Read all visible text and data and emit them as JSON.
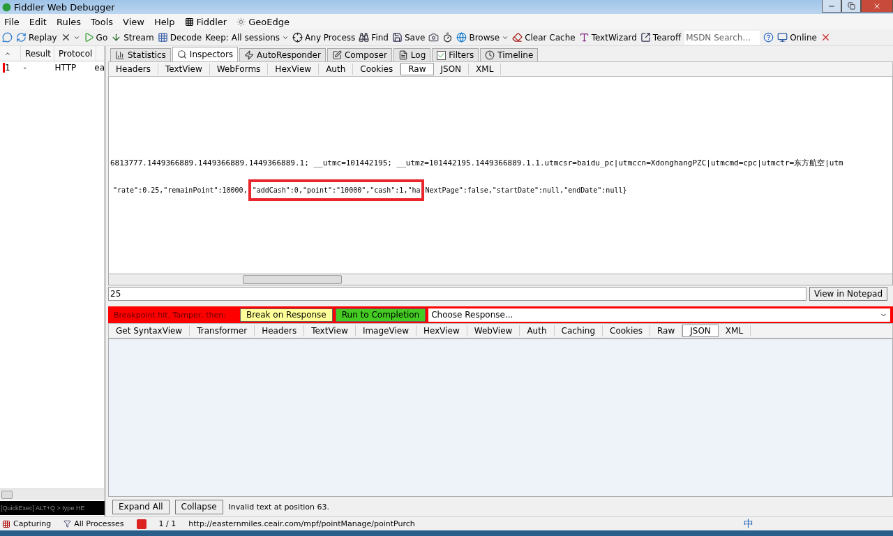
{
  "window": {
    "title": "Fiddler Web Debugger"
  },
  "menu": [
    {
      "label": "File",
      "kind": "text"
    },
    {
      "label": "Edit",
      "kind": "text"
    },
    {
      "label": "Rules",
      "kind": "text"
    },
    {
      "label": "Tools",
      "kind": "text"
    },
    {
      "label": "View",
      "kind": "text"
    },
    {
      "label": "Help",
      "kind": "text"
    },
    {
      "label": "Fiddler",
      "kind": "icon"
    },
    {
      "label": "GeoEdge",
      "kind": "icon"
    }
  ],
  "toolbar": [
    {
      "kind": "icon"
    },
    {
      "label": "Replay",
      "kind": "button"
    },
    {
      "kind": "dropdown"
    },
    {
      "label": "Go",
      "kind": "button"
    },
    {
      "label": "Stream",
      "kind": "button"
    },
    {
      "label": "Decode",
      "kind": "button"
    },
    {
      "label": "Keep: All sessions",
      "kind": "dropdown"
    },
    {
      "label": "Any Process",
      "kind": "button"
    },
    {
      "label": "Find",
      "kind": "button"
    },
    {
      "label": "Save",
      "kind": "button"
    },
    {
      "kind": "icon"
    },
    {
      "kind": "icon"
    },
    {
      "label": "Browse",
      "kind": "dropdown"
    },
    {
      "label": "Clear Cache",
      "kind": "button"
    },
    {
      "label": "TextWizard",
      "kind": "button"
    },
    {
      "label": "Tearoff",
      "kind": "button"
    },
    {
      "placeholder": "MSDN Search...",
      "kind": "field"
    },
    {
      "kind": "icon"
    },
    {
      "label": "Online",
      "kind": "button"
    },
    {
      "kind": "icon"
    }
  ],
  "sessions": {
    "columns": [
      "Result",
      "Protocol"
    ],
    "rows": [
      {
        "number": "1",
        "result": "-",
        "protocol": "HTTP",
        "host": "ea",
        "selected": false
      }
    ],
    "quickexec": {
      "placeholder": "[QuickExec] ALT+Q > type HE"
    }
  },
  "tabs": [
    {
      "label": "Statistics",
      "kind": "tab",
      "selected": false
    },
    {
      "label": "Inspectors",
      "kind": "tab",
      "selected": true
    },
    {
      "label": "AutoResponder",
      "kind": "tab",
      "selected": false
    },
    {
      "label": "Composer",
      "kind": "tab",
      "selected": false
    },
    {
      "label": "Log",
      "kind": "tab",
      "selected": false
    },
    {
      "label": "Filters",
      "kind": "checkbox",
      "checked": true,
      "selected": false
    },
    {
      "label": "Timeline",
      "kind": "tab",
      "selected": false
    }
  ],
  "request": {
    "tabs": [
      {
        "label": "Headers",
        "selected": false
      },
      {
        "label": "TextView",
        "selected": false
      },
      {
        "label": "WebForms",
        "selected": false
      },
      {
        "label": "HexView",
        "selected": false
      },
      {
        "label": "Auth",
        "selected": false
      },
      {
        "label": "Cookies",
        "selected": false
      },
      {
        "label": "Raw",
        "selected": true
      },
      {
        "label": "JSON",
        "selected": false
      },
      {
        "label": "XML",
        "selected": false
      }
    ],
    "cookie_line": "6813777.1449366889.1449366889.1449366889.1; __utmc=101442195; __utmz=101442195.1449366889.1.1.utmcsr=baidu_pc|utmccn=XdonghangPZC|utmcmd=cpc|utmctr=东方航空|utm",
    "body_line": {
      "before": "\"rate\":0.25,\"remainPoint\":10000,",
      "highlighted": "\"addCash\":0,\"point\":\"10000\",\"cash\":1,\"ha",
      "after": "NextPage\":false,\"startDate\":null,\"endDate\":null}"
    },
    "find_value": "25",
    "notepad_button": "View in Notepad"
  },
  "breakpoint": {
    "label": "Breakpoint hit. Tamper, then:",
    "buttons": [
      {
        "label": "Break on Response",
        "kind": "yellow"
      },
      {
        "label": "Run to Completion",
        "kind": "green"
      }
    ],
    "response_select": "Choose Response..."
  },
  "response": {
    "tabs": [
      {
        "label": "Get SyntaxView",
        "selected": false
      },
      {
        "label": "Transformer",
        "selected": false
      },
      {
        "label": "Headers",
        "selected": false
      },
      {
        "label": "TextView",
        "selected": false
      },
      {
        "label": "ImageView",
        "selected": false
      },
      {
        "label": "HexView",
        "selected": false
      },
      {
        "label": "WebView",
        "selected": false
      },
      {
        "label": "Auth",
        "selected": false
      },
      {
        "label": "Caching",
        "selected": false
      },
      {
        "label": "Cookies",
        "selected": false
      },
      {
        "label": "Raw",
        "selected": false
      },
      {
        "label": "JSON",
        "selected": true
      },
      {
        "label": "XML",
        "selected": false
      }
    ],
    "buttons": [
      "Expand All",
      "Collapse"
    ],
    "message": "Invalid text at position 63."
  },
  "status_bar": {
    "capturing": "Capturing",
    "processes": "All Processes",
    "count": "1 / 1",
    "url": "http://easternmiles.ceair.com/mpf/pointManage/pointPurch",
    "ime": "中"
  }
}
